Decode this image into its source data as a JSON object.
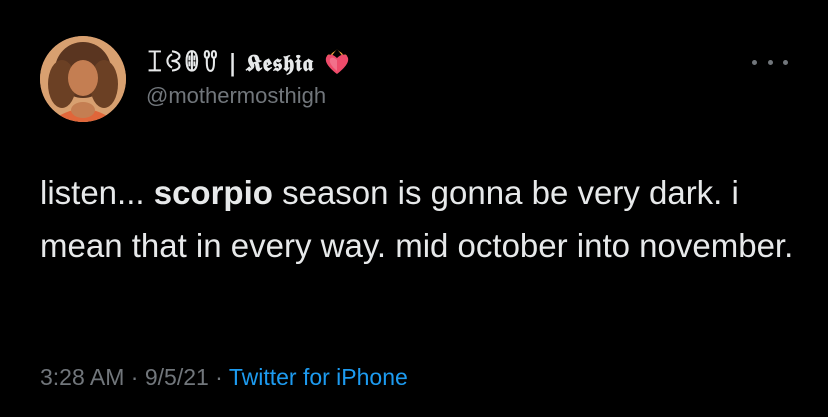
{
  "user": {
    "display_name": "ꀤꃳꂦꀎ | 𝕶𝖊𝖘𝖍𝖎𝖆",
    "handle": "@mothermosthigh",
    "badge_icon": "heart-on-fire-icon"
  },
  "tweet": {
    "text_before": "listen... ",
    "text_bold": "scorpio",
    "text_after": " season is gonna be very dark. i mean that in every way. mid october into november."
  },
  "meta": {
    "time": "3:28 AM",
    "sep1": " · ",
    "date": "9/5/21",
    "sep2": " · ",
    "source": "Twitter for iPhone"
  },
  "colors": {
    "background": "#000000",
    "text": "#e7e9ea",
    "secondary": "#71767b",
    "link": "#1d9bf0"
  }
}
